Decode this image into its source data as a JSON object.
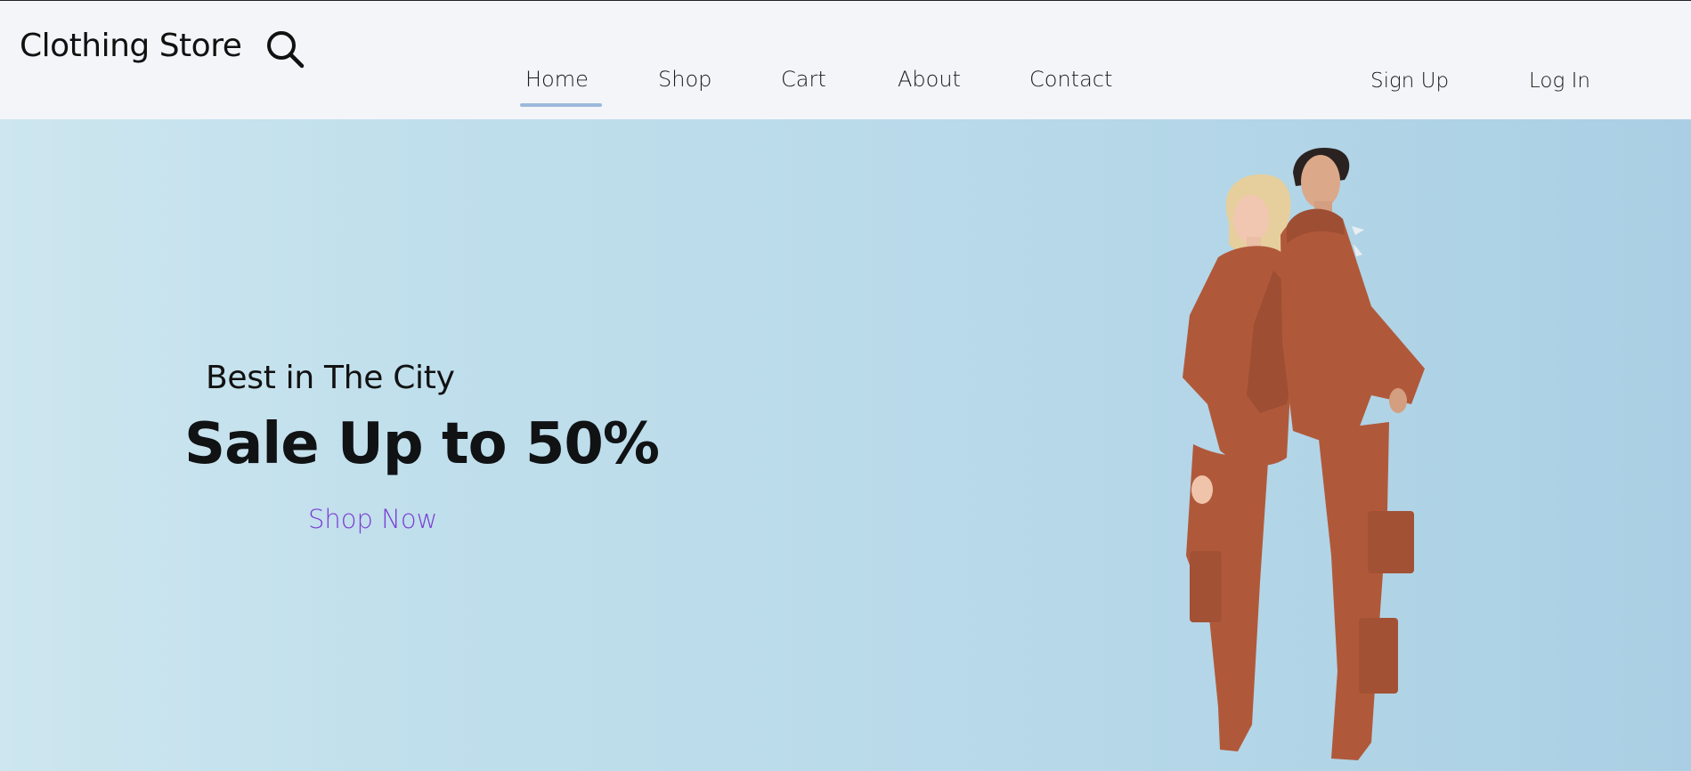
{
  "header": {
    "brand": "Clothing Store",
    "search_icon": "search-icon",
    "nav": [
      {
        "label": "Home",
        "active": true
      },
      {
        "label": "Shop",
        "active": false
      },
      {
        "label": "Cart",
        "active": false
      },
      {
        "label": "About",
        "active": false
      },
      {
        "label": "Contact",
        "active": false
      }
    ],
    "auth": {
      "signup": "Sign Up",
      "login": "Log In"
    }
  },
  "hero": {
    "tagline": "Best in The City",
    "headline": "Sale Up to 50%",
    "cta": "Shop Now",
    "image": "two models in matching rust-brown hoodies and cargo sweatpants standing back to back"
  },
  "colors": {
    "accent": "#7b3fd4",
    "nav_underline": "#9bb9dc",
    "header_bg": "#f4f5f9",
    "hero_bg_start": "#cde6ef",
    "hero_bg_end": "#aacfe4",
    "outfit": "#b0593a"
  }
}
